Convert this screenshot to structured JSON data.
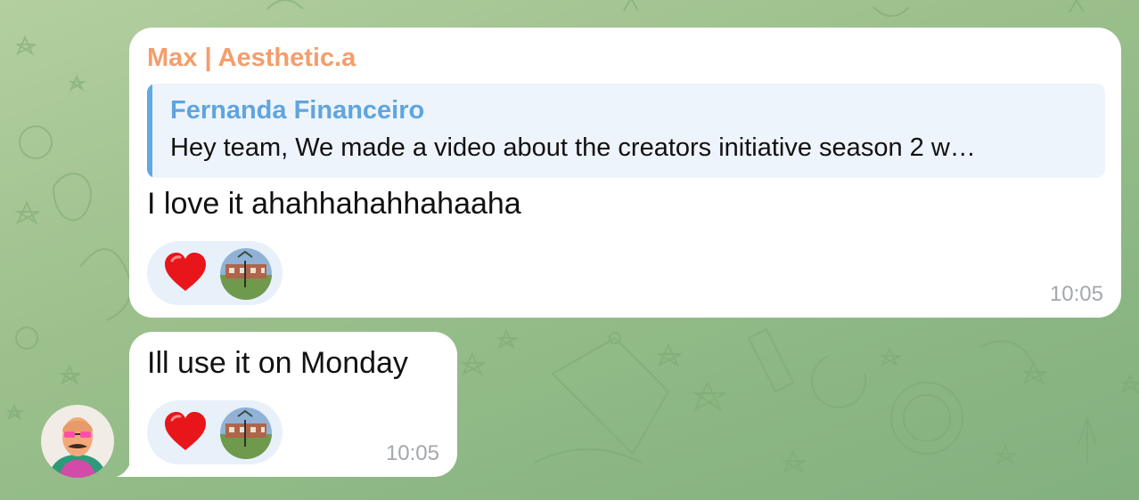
{
  "colors": {
    "sender_name": "#f49d6c",
    "reply_author": "#5fa5df",
    "reply_bar": "#62a8e3",
    "reaction_bg": "#e8f0fa",
    "bubble_bg": "#ffffff",
    "time": "#a2a8ad"
  },
  "messages": [
    {
      "sender": "Max | Aesthetic.a",
      "reply": {
        "author": "Fernanda Financeiro",
        "text": "Hey team, We made a video about the creators initiative season 2 w…"
      },
      "text": "I love it ahahhahahhahaaha",
      "reaction_icon": "red-heart-icon",
      "time": "10:05"
    },
    {
      "text": "Ill use it on Monday",
      "reaction_icon": "red-heart-icon",
      "time": "10:05"
    }
  ]
}
